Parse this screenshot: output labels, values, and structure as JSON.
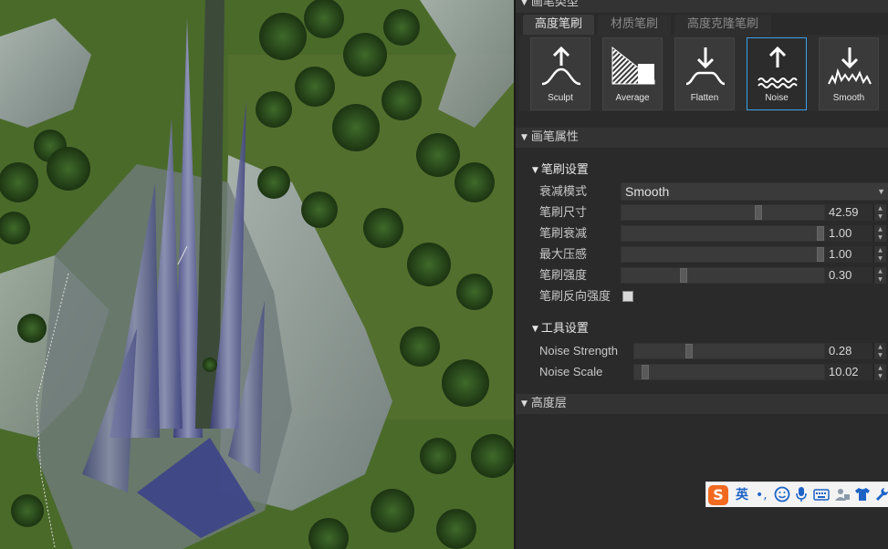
{
  "panel": {
    "brush_type_header": "画笔类型",
    "tabs": [
      {
        "label": "高度笔刷",
        "active": true
      },
      {
        "label": "材质笔刷",
        "active": false
      },
      {
        "label": "高度克隆笔刷",
        "active": false
      }
    ],
    "tools": [
      {
        "label": "Sculpt",
        "icon": "sculpt-icon"
      },
      {
        "label": "Average",
        "icon": "average-icon"
      },
      {
        "label": "Flatten",
        "icon": "flatten-icon"
      },
      {
        "label": "Noise",
        "icon": "noise-icon",
        "selected": true
      },
      {
        "label": "Smooth",
        "icon": "smooth-icon"
      }
    ],
    "brush_props_header": "画笔属性",
    "brush_settings": {
      "title": "笔刷设置",
      "falloff_label": "衰减模式",
      "falloff_value": "Smooth",
      "size_label": "笔刷尺寸",
      "size_value": "42.59",
      "falloff_amount_label": "笔刷衰减",
      "falloff_amount_value": "1.00",
      "max_pressure_label": "最大压感",
      "max_pressure_value": "1.00",
      "strength_label": "笔刷强度",
      "strength_value": "0.30",
      "invert_label": "笔刷反向强度"
    },
    "tool_settings": {
      "title": "工具设置",
      "noise_strength_label": "Noise Strength",
      "noise_strength_value": "0.28",
      "noise_scale_label": "Noise Scale",
      "noise_scale_value": "10.02"
    },
    "height_layer_header": "高度层"
  },
  "ime": {
    "logo": "S",
    "lang": "英",
    "punct": "•,"
  },
  "colors": {
    "accent": "#3aa0ea",
    "panel_bg": "#2a2a2a",
    "ime_logo": "#f26a1f"
  }
}
